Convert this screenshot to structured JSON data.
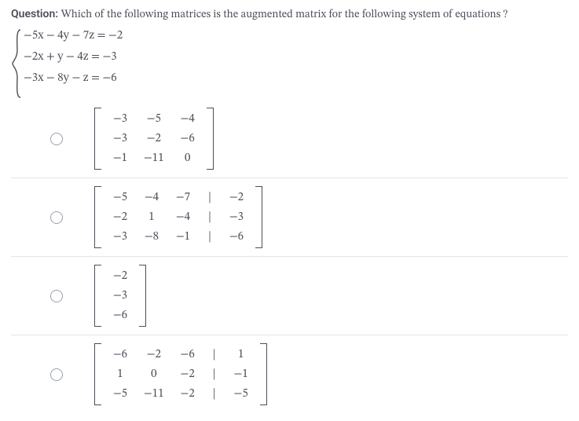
{
  "question": {
    "label": "Question:",
    "text": "Which of the following matrices is the augmented matrix for the following system of equations ?"
  },
  "system": {
    "eq1": "−5x − 4y − 7z = −2",
    "eq2": "−2x + y − 4z = −3",
    "eq3": "−3x − 8y − z = −6"
  },
  "options": {
    "a": {
      "rows": [
        [
          "−3",
          "−5",
          "−4"
        ],
        [
          "−3",
          "−2",
          "−6"
        ],
        [
          "−1",
          "−11",
          "0"
        ]
      ],
      "augmented": false
    },
    "b": {
      "rows": [
        [
          "−5",
          "−4",
          "−7",
          "−2"
        ],
        [
          "−2",
          "1",
          "−4",
          "−3"
        ],
        [
          "−3",
          "−8",
          "−1",
          "−6"
        ]
      ],
      "augmented": true
    },
    "c": {
      "rows": [
        [
          "−2"
        ],
        [
          "−3"
        ],
        [
          "−6"
        ]
      ],
      "augmented": false
    },
    "d": {
      "rows": [
        [
          "−6",
          "−2",
          "−6",
          "1"
        ],
        [
          "1",
          "0",
          "−2",
          "−1"
        ],
        [
          "−5",
          "−11",
          "−2",
          "−5"
        ]
      ],
      "augmented": true
    }
  }
}
